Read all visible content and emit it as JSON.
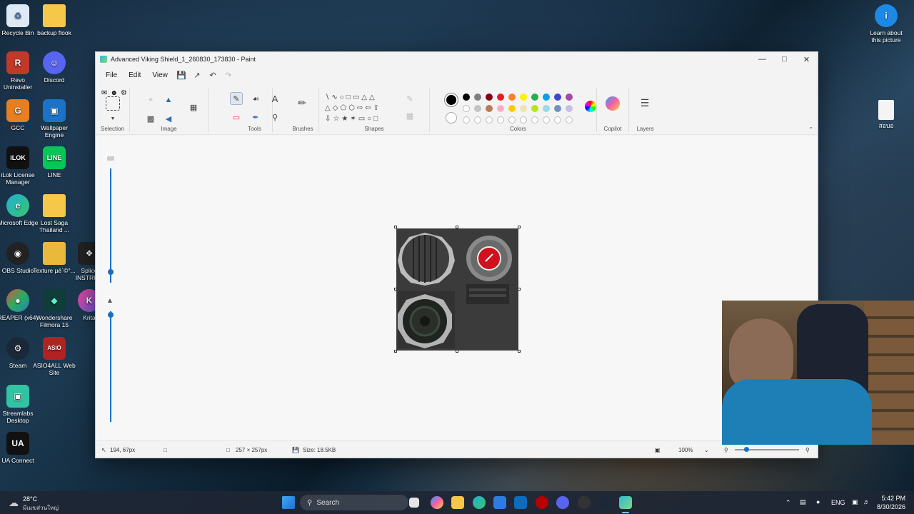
{
  "desktop": {
    "icons_col1": [
      {
        "label": "Recycle Bin"
      },
      {
        "label": "Revo Uninstaller"
      },
      {
        "label": "GCC"
      },
      {
        "label": "iLok License Manager"
      },
      {
        "label": "Microsoft Edge"
      },
      {
        "label": "OBS Studio"
      },
      {
        "label": "REAPER (x64)"
      },
      {
        "label": "Steam"
      },
      {
        "label": "Streamlabs Desktop"
      },
      {
        "label": "UA Connect"
      }
    ],
    "icons_col2": [
      {
        "label": "backup flook"
      },
      {
        "label": "Discord"
      },
      {
        "label": "Wallpaper Engine"
      },
      {
        "label": "LINE"
      },
      {
        "label": "Lost Saga Thailand ..."
      },
      {
        "label": "Texture µé`©°..."
      },
      {
        "label": "Wondershare Filmora 15"
      },
      {
        "label": "ASIO4ALL Web Site"
      }
    ],
    "icons_col3": [
      {
        "label": "Splice INSTRU..."
      },
      {
        "label": "Krita"
      }
    ],
    "learn_about": "Learn about this picture",
    "file_icon_label": "สอบอ"
  },
  "paint": {
    "title": "Advanced Viking Shield_1_260830_173830 - Paint",
    "menu": [
      "File",
      "Edit",
      "View"
    ],
    "groups": {
      "selection": "Selection",
      "image": "Image",
      "tools": "Tools",
      "brushes": "Brushes",
      "shapes": "Shapes",
      "colors": "Colors",
      "copilot": "Copilot",
      "layers": "Layers"
    },
    "palette_row1": [
      "#000000",
      "#7f7f7f",
      "#880015",
      "#ed1c24",
      "#ff7f27",
      "#fff200",
      "#22b14c",
      "#00a2e8",
      "#3f48cc",
      "#a349a4"
    ],
    "palette_row2": [
      "#ffffff",
      "#c3c3c3",
      "#b97a57",
      "#ffaec9",
      "#ffc90e",
      "#efe4b0",
      "#b5e61d",
      "#99d9ea",
      "#7092be",
      "#c8bfe7"
    ],
    "status": {
      "cursor": "194, 67px",
      "canvas_size": "257 × 257px",
      "file_size": "Size: 18.5KB",
      "zoom": "100%"
    }
  },
  "taskbar": {
    "weather_temp": "28°C",
    "weather_desc": "มีเมฆส่วนใหญ่",
    "search_placeholder": "Search",
    "lang": "ENG",
    "time": "5:42 PM",
    "date": "8/30/2026"
  }
}
